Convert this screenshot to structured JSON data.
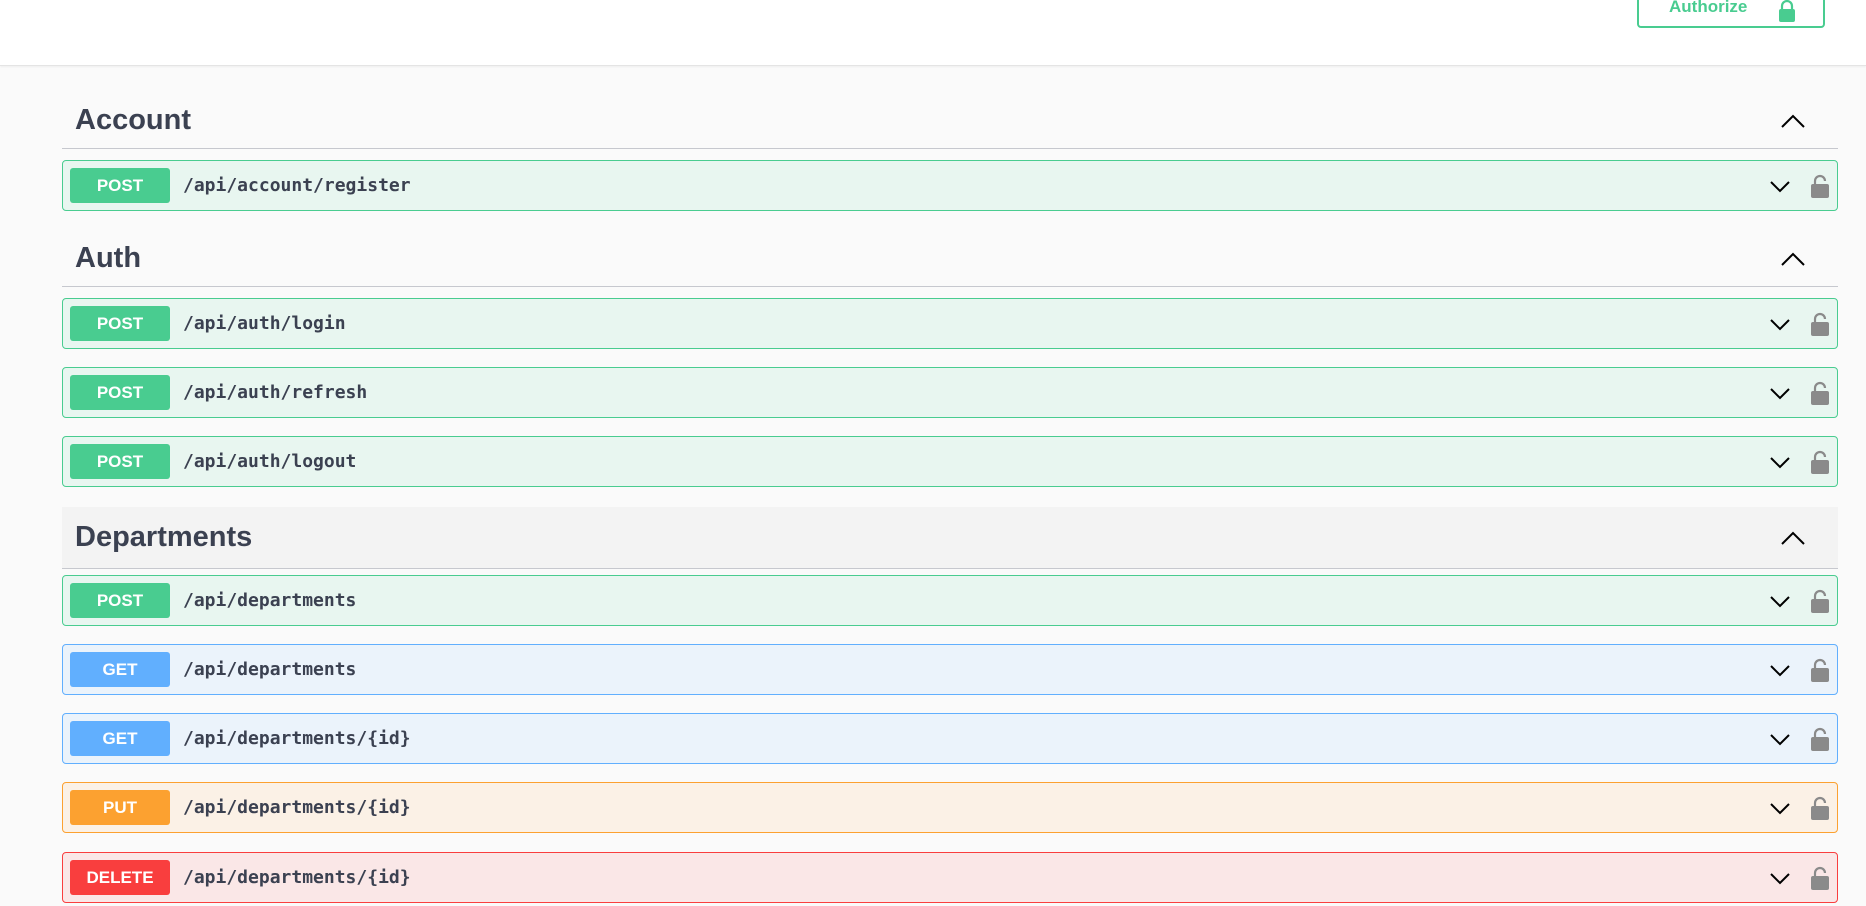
{
  "topbar": {
    "authorize_label": "Authorize"
  },
  "sections": [
    {
      "title": "Account",
      "operations": [
        {
          "method": "POST",
          "path": "/api/account/register"
        }
      ]
    },
    {
      "title": "Auth",
      "operations": [
        {
          "method": "POST",
          "path": "/api/auth/login"
        },
        {
          "method": "POST",
          "path": "/api/auth/refresh"
        },
        {
          "method": "POST",
          "path": "/api/auth/logout"
        }
      ]
    },
    {
      "title": "Departments",
      "operations": [
        {
          "method": "POST",
          "path": "/api/departments"
        },
        {
          "method": "GET",
          "path": "/api/departments"
        },
        {
          "method": "GET",
          "path": "/api/departments/{id}"
        },
        {
          "method": "PUT",
          "path": "/api/departments/{id}"
        },
        {
          "method": "DELETE",
          "path": "/api/departments/{id}"
        }
      ]
    }
  ],
  "icons": {
    "section_toggle": "chevron-up-icon",
    "operation_toggle": "chevron-down-icon",
    "operation_lock": "lock-icon"
  },
  "colors": {
    "post": "#49cc90",
    "get": "#61affe",
    "put": "#fca130",
    "delete": "#f93e3e",
    "lock": "#8a8a8a"
  }
}
